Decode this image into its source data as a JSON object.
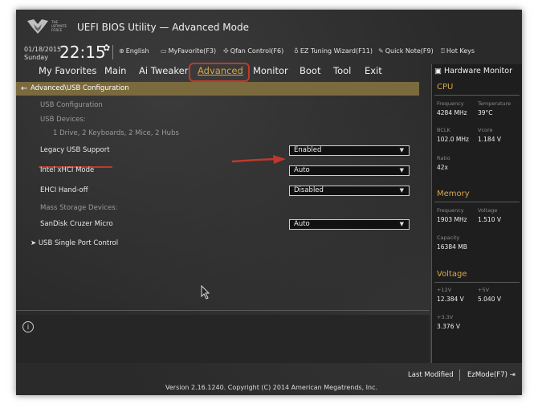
{
  "header": {
    "logo_text": "THE ULTIMATE FORCE",
    "title": "UEFI BIOS Utility — Advanced Mode",
    "date": "01/18/2015",
    "weekday": "Sunday",
    "time": "22:15",
    "tools": [
      "English",
      "MyFavorite(F3)",
      "Qfan Control(F6)",
      "EZ Tuning Wizard(F11)",
      "Quick Note(F9)",
      "Hot Keys"
    ]
  },
  "menu": {
    "items": [
      "My Favorites",
      "Main",
      "Ai Tweaker",
      "Advanced",
      "Monitor",
      "Boot",
      "Tool",
      "Exit"
    ],
    "active": "Advanced"
  },
  "breadcrumb": "Advanced\\USB Configuration",
  "settings": {
    "usb_configuration": "USB Configuration",
    "usb_devices": "USB Devices:",
    "devices_summary": "1 Drive, 2 Keyboards, 2 Mice, 2 Hubs",
    "legacy_usb_support": {
      "label": "Legacy USB Support",
      "value": "Enabled"
    },
    "intel_xhci_mode": {
      "label": "Intel xHCI Mode",
      "value": "Auto"
    },
    "ehci_handoff": {
      "label": "EHCI Hand-off",
      "value": "Disabled"
    },
    "mass_storage_devices": "Mass Storage Devices:",
    "sandisk": {
      "label": "SanDisk Cruzer Micro",
      "value": "Auto"
    },
    "single_port_control": "USB Single Port Control"
  },
  "footer": {
    "last_modified": "Last Modified",
    "ezmode": "EzMode(F7)",
    "version": "Version 2.16.1240. Copyright (C) 2014 American Megatrends, Inc."
  },
  "hardware_monitor": {
    "title": "Hardware Monitor",
    "cpu": {
      "section": "CPU",
      "frequency_label": "Frequency",
      "frequency": "4284 MHz",
      "temperature_label": "Temperature",
      "temperature": "39°C",
      "bclk_label": "BCLK",
      "bclk": "102.0 MHz",
      "vcore_label": "Vcore",
      "vcore": "1.184 V",
      "ratio_label": "Ratio",
      "ratio": "42x"
    },
    "memory": {
      "section": "Memory",
      "frequency_label": "Frequency",
      "frequency": "1903 MHz",
      "voltage_label": "Voltage",
      "voltage": "1.510 V",
      "capacity_label": "Capacity",
      "capacity": "16384 MB"
    },
    "voltage": {
      "section": "Voltage",
      "v12_label": "+12V",
      "v12": "12.384 V",
      "v5_label": "+5V",
      "v5": "5.040 V",
      "v33_label": "+3.3V",
      "v33": "3.376 V"
    }
  },
  "colors": {
    "accent": "#d9a64a",
    "breadcrumb_bg": "#7a6a3e",
    "annotation_red": "#c0392b"
  }
}
